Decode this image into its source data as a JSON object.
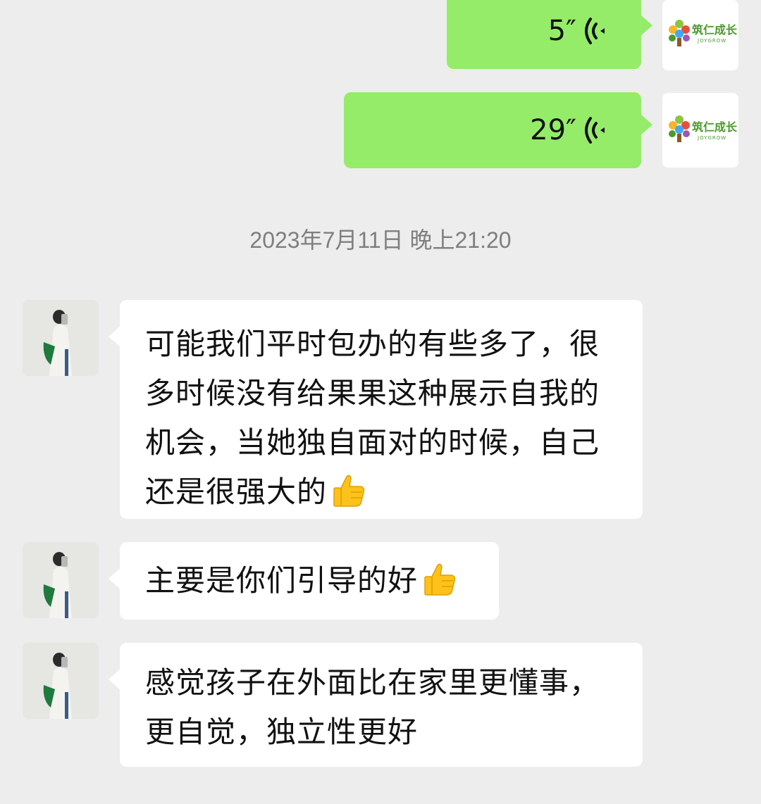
{
  "brand": {
    "name": "筑仁成长",
    "sub": "JOYGROW",
    "accent_color": "#4a9a2e"
  },
  "messages_out": [
    {
      "type": "voice",
      "duration": "5″",
      "icon": "voice-wave-icon"
    },
    {
      "type": "voice",
      "duration": "29″",
      "icon": "voice-wave-icon"
    }
  ],
  "timestamp": "2023年7月11日 晚上21:20",
  "messages_in": [
    {
      "type": "text",
      "lines": [
        "可能我们平时包办的有些多了，很",
        "多时候没有给果果这种展示自我的",
        "机会，当她独自面对的时候，自己",
        "还是很强大的"
      ],
      "emoji": "thumbs-up-icon"
    },
    {
      "type": "text",
      "lines": [
        "主要是你们引导的好"
      ],
      "emoji": "thumbs-up-icon"
    },
    {
      "type": "text",
      "lines": [
        "感觉孩子在外面比在家里更懂事，",
        "更自觉，独立性更好"
      ]
    }
  ],
  "colors": {
    "background": "#ededed",
    "outgoing_bubble": "#95ec69",
    "incoming_bubble": "#ffffff",
    "timestamp_text": "#7e7e7e"
  }
}
